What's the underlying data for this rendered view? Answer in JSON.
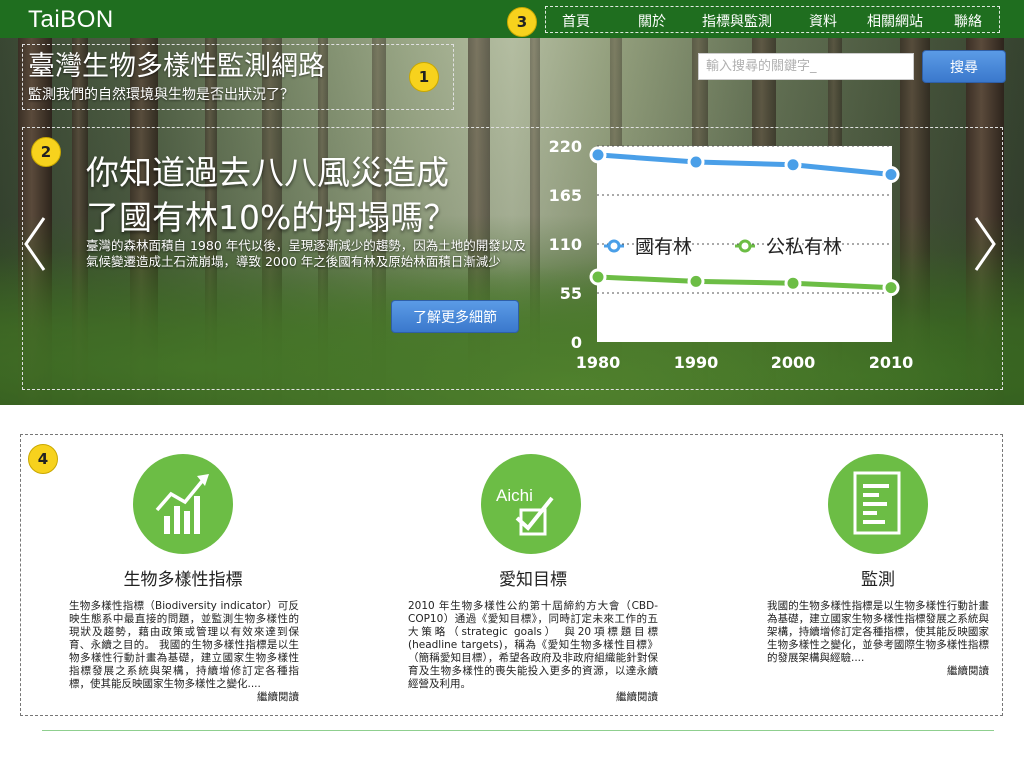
{
  "header": {
    "brand": "TaiBON",
    "nav": [
      "首頁",
      "關於",
      "指標與監測",
      "資料",
      "相關網站",
      "聯絡"
    ]
  },
  "hero": {
    "title": "臺灣生物多樣性監測網路",
    "subtitle": "監測我們的自然環境與生物是否出狀況了？",
    "search": {
      "placeholder": "輸入搜尋的關鍵字_",
      "button_label": "搜尋"
    },
    "feature": {
      "headline_line1": "你知道過去八八風災造成",
      "headline_line2": "了國有林10%的坍塌嗎？",
      "description": "臺灣的森林面積自 1980 年代以後，呈現逐漸減少的趨勢，因為土地的開發以及氣候變遷造成土石流崩塌，導致 2000 年之後國有林及原始林面積日漸減少",
      "button_label": "了解更多細節"
    },
    "prev_icon": "chevron-left-icon",
    "next_icon": "chevron-right-icon"
  },
  "badges": [
    "1",
    "2",
    "3",
    "4"
  ],
  "chart_data": {
    "type": "line",
    "title": "",
    "xlabel": "",
    "ylabel": "",
    "categories": [
      "1980",
      "1990",
      "2000",
      "2010"
    ],
    "yticks": [
      "0",
      "55",
      "110",
      "165",
      "220"
    ],
    "ylim": [
      0,
      220
    ],
    "grid": true,
    "legend_position": "center",
    "series": [
      {
        "name": "國有林",
        "values": [
          210,
          202,
          199,
          188
        ],
        "color": "#4a9fe8"
      },
      {
        "name": "公私有林",
        "values": [
          73,
          68,
          66,
          61
        ],
        "color": "#6cbd45"
      }
    ]
  },
  "cards": [
    {
      "icon": "bar-chart-trend-icon",
      "title": "生物多樣性指標",
      "text": "生物多樣性指標（Biodiversity indicator）可反映生態系中最直接的問題，並監測生物多樣性的現狀及趨勢，藉由政策或管理以有效來達到保育、永續之目的。 我國的生物多樣性指標是以生物多樣性行動計畫為基礎，建立國家生物多樣性指標發展之系統與架構，持續增修訂定各種指標，使其能反映國家生物多樣性之變化....",
      "read_more": "繼續閱讀"
    },
    {
      "icon": "aichi-checkbox-icon",
      "icon_label": "Aichi",
      "title": "愛知目標",
      "text": "2010 年生物多樣性公約第十屆締約方大會（CBD-COP10）通過《愛知目標》，同時訂定未來工作的五大策略（strategic goals） 與20項標題目標(headline targets)，稱為《愛知生物多樣性目標》（簡稱愛知目標），希望各政府及非政府組織能針對保育及生物多樣性的喪失能投入更多的資源，以達永續經營及利用。",
      "read_more": "繼續閱讀"
    },
    {
      "icon": "document-report-icon",
      "title": "監測",
      "text": "我國的生物多樣性指標是以生物多樣性行動計畫為基礎，建立國家生物多樣性指標發展之系統與架構，持續增修訂定各種指標，使其能反映國家生物多樣性之變化，並參考國際生物多樣性指標的發展架構與經驗....",
      "read_more": "繼續閱讀"
    }
  ],
  "colors": {
    "header_green": "#1f6e1f",
    "button_blue": "#3a78cc",
    "icon_green": "#6cbd45",
    "badge_yellow": "#f7d21d",
    "series_blue": "#4a9fe8",
    "series_green": "#6cbd45"
  }
}
